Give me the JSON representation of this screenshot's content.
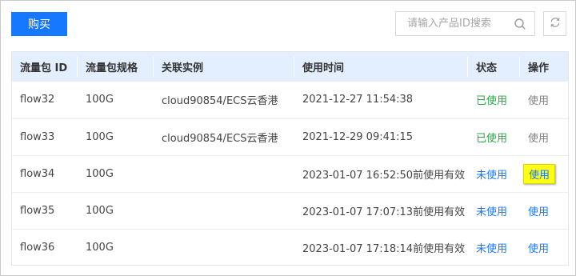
{
  "toolbar": {
    "buy_label": "购买",
    "search_placeholder": "请输入产品ID搜索"
  },
  "table": {
    "headers": [
      "流量包 ID",
      "流量包规格",
      "关联实例",
      "使用时间",
      "状态",
      "操作"
    ],
    "rows": [
      {
        "id": "flow32",
        "spec": "100G",
        "instance": "cloud90854/ECS云香港",
        "time": "2021-12-27 11:54:38",
        "status": "已使用",
        "status_kind": "used",
        "action": "使用",
        "action_kind": "disabled"
      },
      {
        "id": "flow33",
        "spec": "100G",
        "instance": "cloud90854/ECS云香港",
        "time": "2021-12-29 09:41:15",
        "status": "已使用",
        "status_kind": "used",
        "action": "使用",
        "action_kind": "disabled"
      },
      {
        "id": "flow34",
        "spec": "100G",
        "instance": "",
        "time": "2023-01-07 16:52:50前使用有效",
        "status": "未使用",
        "status_kind": "unused",
        "action": "使用",
        "action_kind": "highlight"
      },
      {
        "id": "flow35",
        "spec": "100G",
        "instance": "",
        "time": "2023-01-07 17:07:13前使用有效",
        "status": "未使用",
        "status_kind": "unused",
        "action": "使用",
        "action_kind": "link"
      },
      {
        "id": "flow36",
        "spec": "100G",
        "instance": "",
        "time": "2023-01-07 17:18:14前使用有效",
        "status": "未使用",
        "status_kind": "unused",
        "action": "使用",
        "action_kind": "link"
      }
    ]
  },
  "icons": {
    "search": "search-icon",
    "refresh": "refresh-icon"
  },
  "colors": {
    "primary": "#1677ff",
    "used_status": "#28a745",
    "header_bg": "#e3efff",
    "highlight": "#ffff14"
  }
}
